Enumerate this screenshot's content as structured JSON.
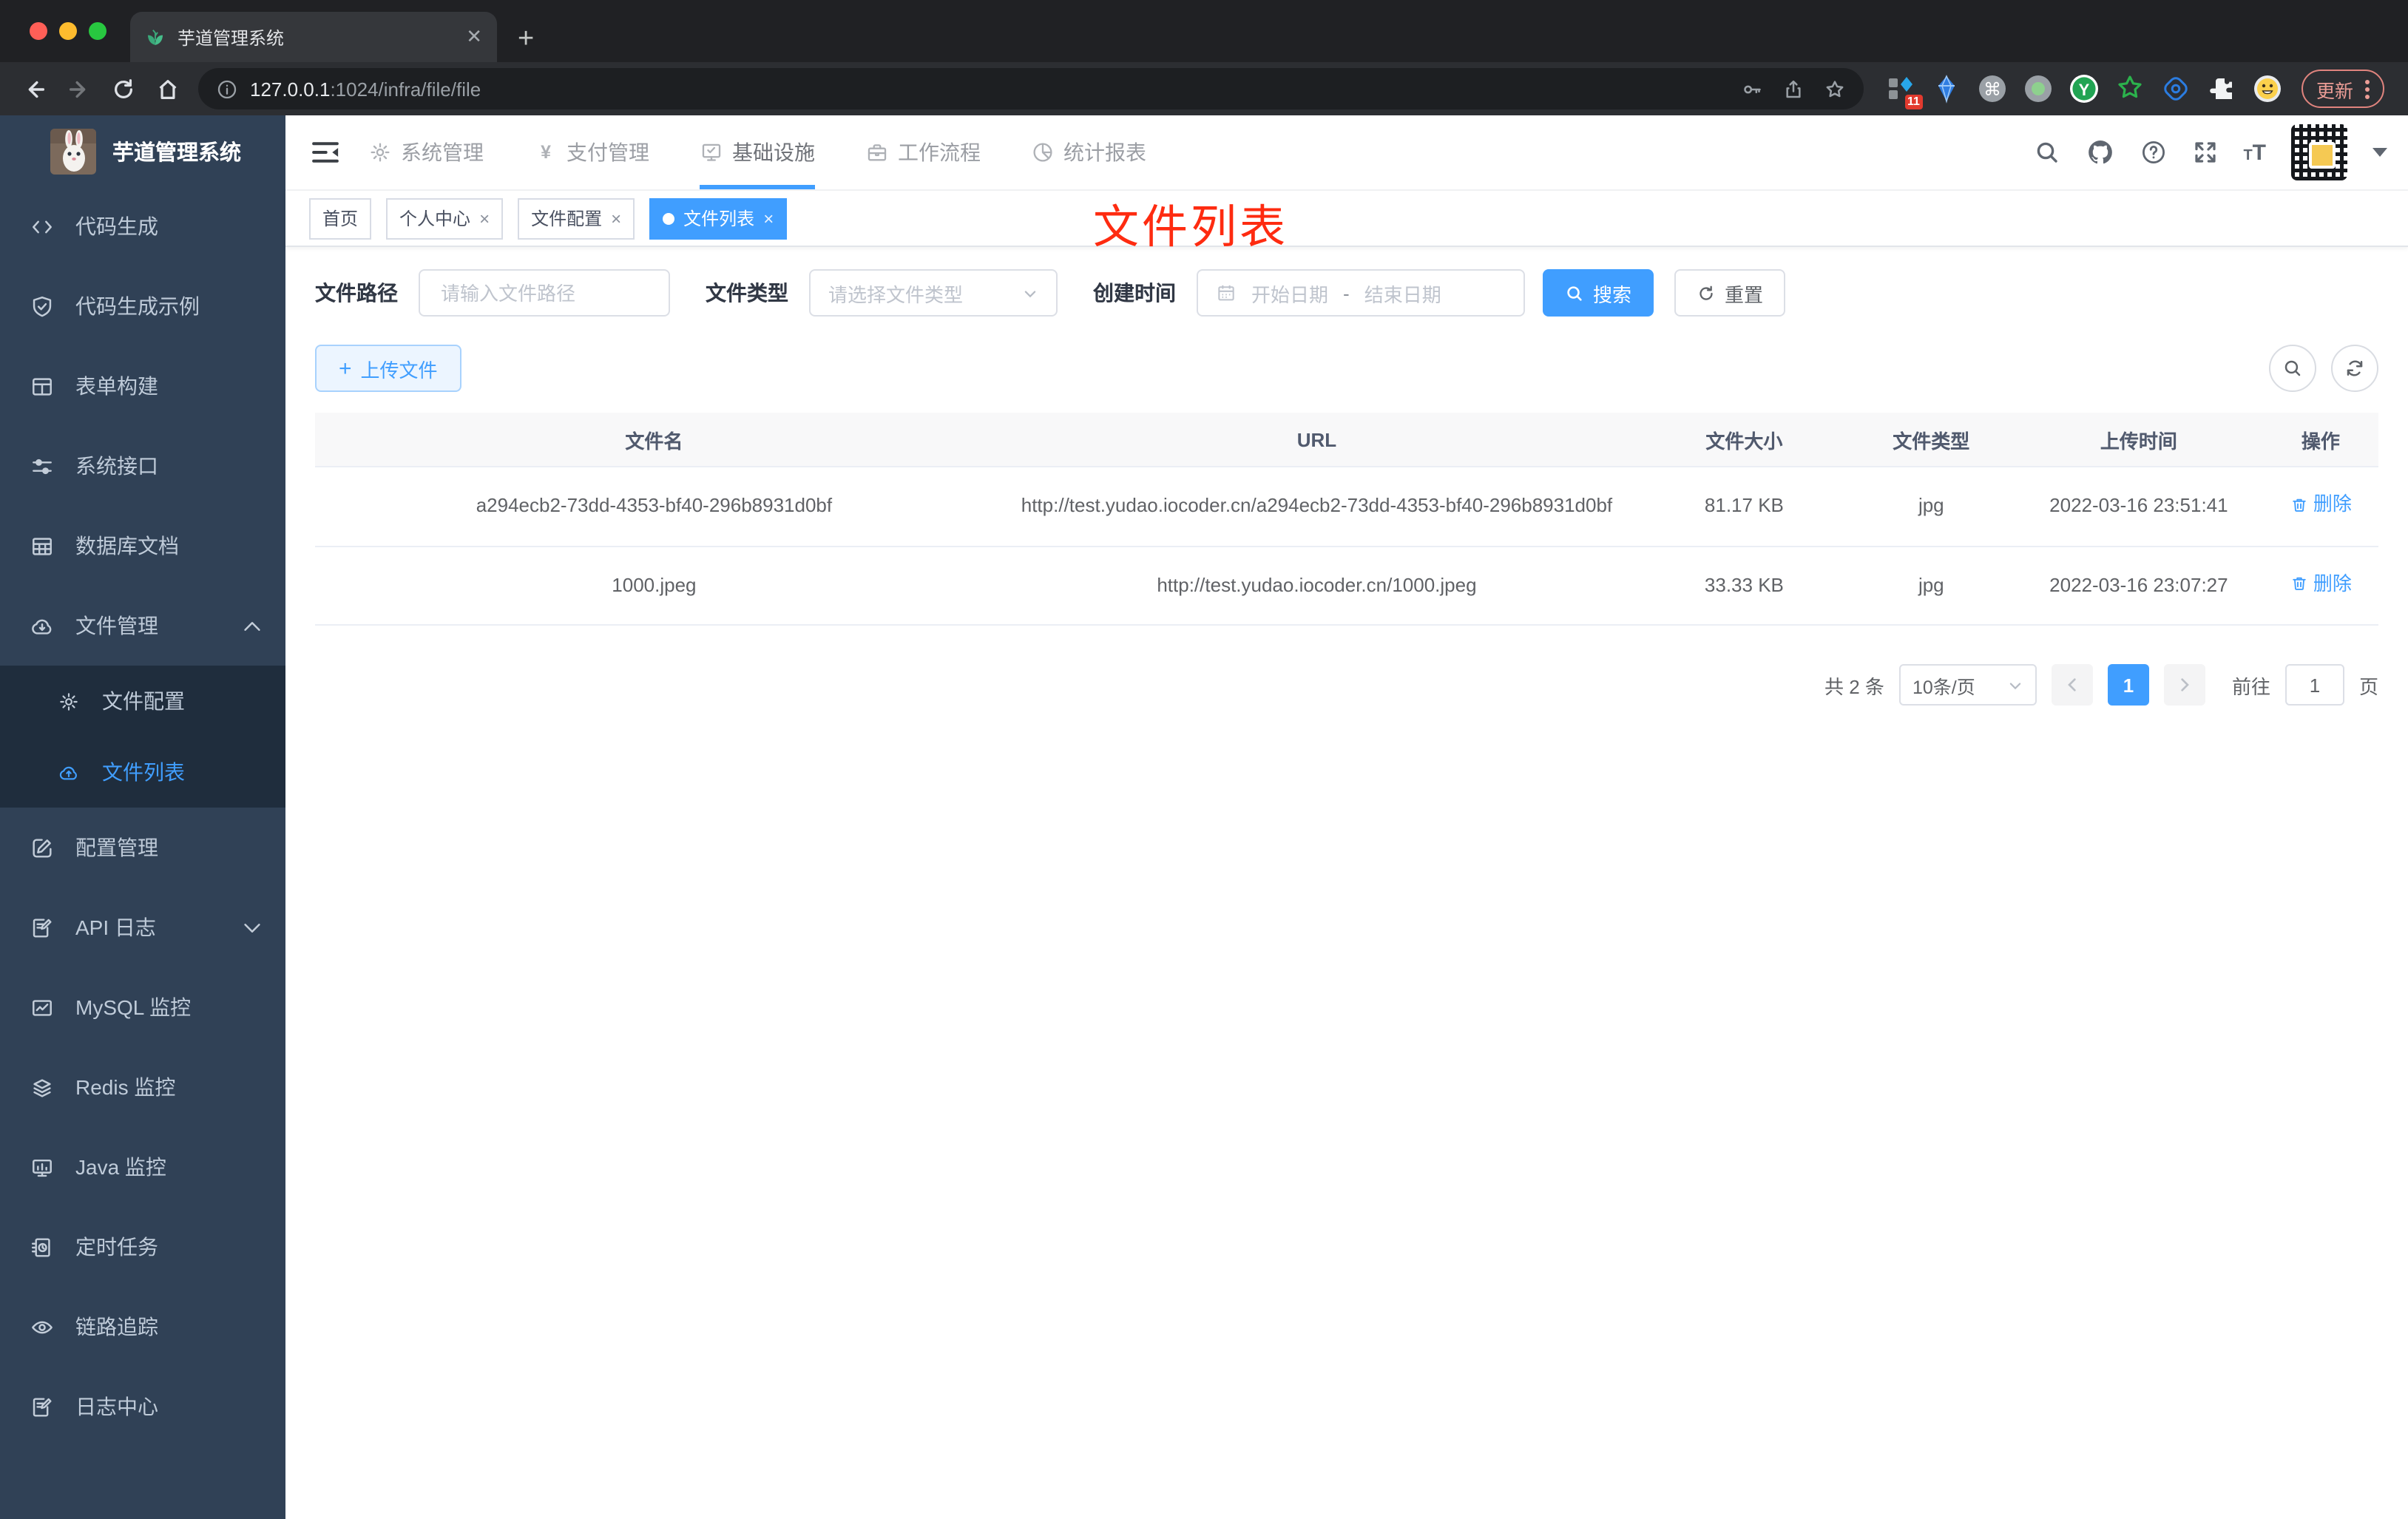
{
  "browser": {
    "tab_title": "芋道管理系统",
    "url_host": "127.0.0.1",
    "url_rest": ":1024/infra/file/file",
    "extension_badge": "11",
    "update_button": "更新"
  },
  "appbar": {
    "menus": [
      {
        "label": "系统管理",
        "icon": "gear",
        "active": false
      },
      {
        "label": "支付管理",
        "icon": "yen",
        "active": false
      },
      {
        "label": "基础设施",
        "icon": "monitor-check",
        "active": true
      },
      {
        "label": "工作流程",
        "icon": "briefcase",
        "active": false
      },
      {
        "label": "统计报表",
        "icon": "pie",
        "active": false
      }
    ]
  },
  "tags": [
    {
      "label": "首页",
      "closable": false,
      "active": false
    },
    {
      "label": "个人中心",
      "closable": true,
      "active": false
    },
    {
      "label": "文件配置",
      "closable": true,
      "active": false
    },
    {
      "label": "文件列表",
      "closable": true,
      "active": true
    }
  ],
  "overlay_title": "文件列表",
  "sidebar": {
    "title": "芋道管理系统",
    "items": [
      {
        "label": "代码生成",
        "icon": "code"
      },
      {
        "label": "代码生成示例",
        "icon": "shield"
      },
      {
        "label": "表单构建",
        "icon": "form"
      },
      {
        "label": "系统接口",
        "icon": "sliders"
      },
      {
        "label": "数据库文档",
        "icon": "dbtable"
      },
      {
        "label": "文件管理",
        "icon": "cloud-down",
        "chevron": "up",
        "children": [
          {
            "label": "文件配置",
            "icon": "gear",
            "active": false
          },
          {
            "label": "文件列表",
            "icon": "cloud-up",
            "active": true
          }
        ]
      },
      {
        "label": "配置管理",
        "icon": "edit-square"
      },
      {
        "label": "API 日志",
        "icon": "edit-note",
        "chevron": "down"
      },
      {
        "label": "MySQL 监控",
        "icon": "chart-box"
      },
      {
        "label": "Redis 监控",
        "icon": "layers"
      },
      {
        "label": "Java 监控",
        "icon": "monitor-bars"
      },
      {
        "label": "定时任务",
        "icon": "doc-clock"
      },
      {
        "label": "链路追踪",
        "icon": "eye"
      },
      {
        "label": "日志中心",
        "icon": "edit-note"
      }
    ]
  },
  "filters": {
    "path_label": "文件路径",
    "path_placeholder": "请输入文件路径",
    "type_label": "文件类型",
    "type_placeholder": "请选择文件类型",
    "time_label": "创建时间",
    "start_placeholder": "开始日期",
    "separator": "-",
    "end_placeholder": "结束日期",
    "search_label": "搜索",
    "reset_label": "重置"
  },
  "toolbar": {
    "upload_label": "上传文件"
  },
  "table": {
    "columns": [
      "文件名",
      "URL",
      "文件大小",
      "文件类型",
      "上传时间",
      "操作"
    ],
    "rows": [
      {
        "name": "a294ecb2-73dd-4353-bf40-296b8931d0bf",
        "url": "http://test.yudao.iocoder.cn/a294ecb2-73dd-4353-bf40-296b8931d0bf",
        "size": "81.17 KB",
        "type": "jpg",
        "time": "2022-03-16 23:51:41",
        "action": "删除"
      },
      {
        "name": "1000.jpeg",
        "url": "http://test.yudao.iocoder.cn/1000.jpeg",
        "size": "33.33 KB",
        "type": "jpg",
        "time": "2022-03-16 23:07:27",
        "action": "删除"
      }
    ]
  },
  "pagination": {
    "total": "共 2 条",
    "page_size": "10条/页",
    "page": "1",
    "goto_label": "前往",
    "goto_value": "1",
    "unit_label": "页"
  },
  "colors": {
    "accent": "#409eff",
    "sidebar_bg": "#304156",
    "submenu_bg": "#1f2d3d",
    "annotation_red": "#fe2b10"
  }
}
